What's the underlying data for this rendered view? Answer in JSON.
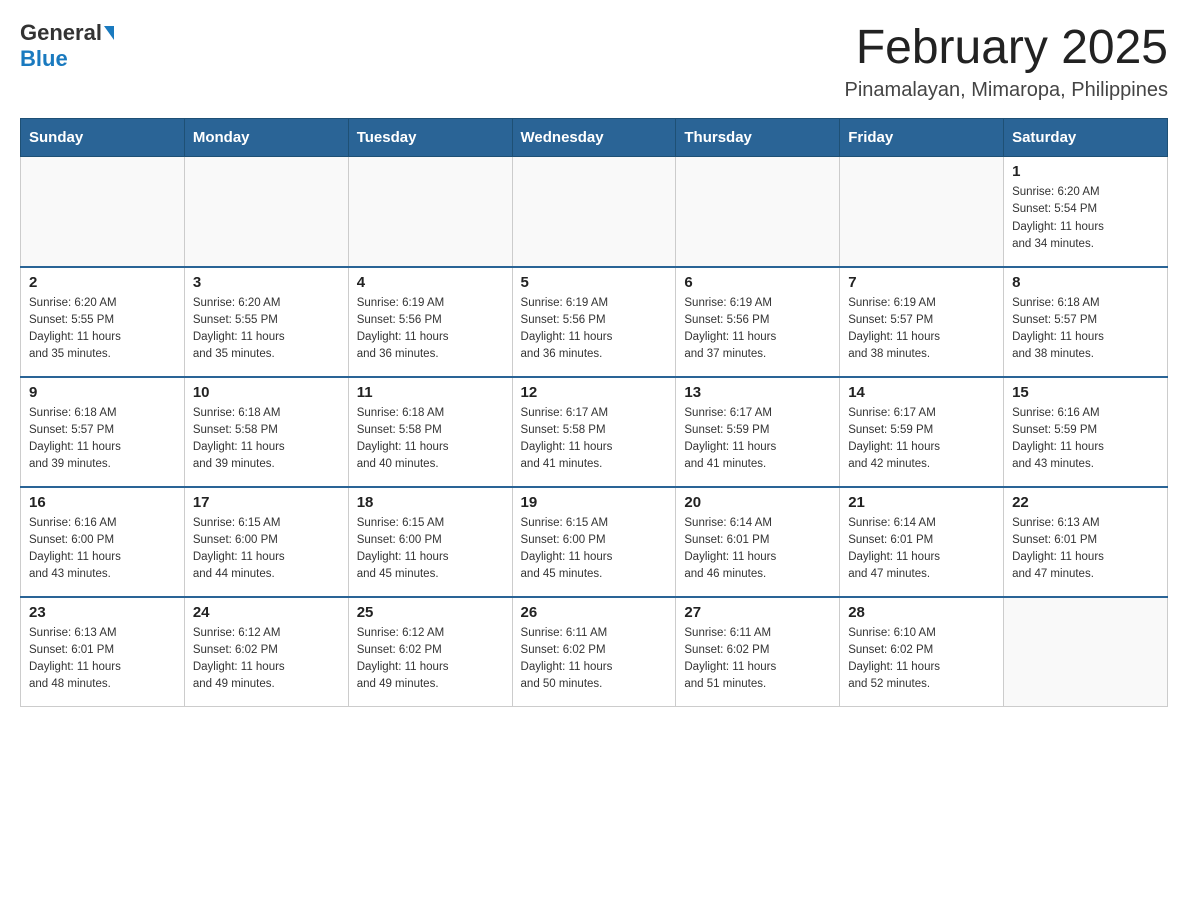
{
  "header": {
    "logo_general": "General",
    "logo_blue": "Blue",
    "main_title": "February 2025",
    "subtitle": "Pinamalayan, Mimaropa, Philippines"
  },
  "days_of_week": [
    "Sunday",
    "Monday",
    "Tuesday",
    "Wednesday",
    "Thursday",
    "Friday",
    "Saturday"
  ],
  "weeks": [
    {
      "days": [
        {
          "num": "",
          "info": ""
        },
        {
          "num": "",
          "info": ""
        },
        {
          "num": "",
          "info": ""
        },
        {
          "num": "",
          "info": ""
        },
        {
          "num": "",
          "info": ""
        },
        {
          "num": "",
          "info": ""
        },
        {
          "num": "1",
          "info": "Sunrise: 6:20 AM\nSunset: 5:54 PM\nDaylight: 11 hours\nand 34 minutes."
        }
      ]
    },
    {
      "days": [
        {
          "num": "2",
          "info": "Sunrise: 6:20 AM\nSunset: 5:55 PM\nDaylight: 11 hours\nand 35 minutes."
        },
        {
          "num": "3",
          "info": "Sunrise: 6:20 AM\nSunset: 5:55 PM\nDaylight: 11 hours\nand 35 minutes."
        },
        {
          "num": "4",
          "info": "Sunrise: 6:19 AM\nSunset: 5:56 PM\nDaylight: 11 hours\nand 36 minutes."
        },
        {
          "num": "5",
          "info": "Sunrise: 6:19 AM\nSunset: 5:56 PM\nDaylight: 11 hours\nand 36 minutes."
        },
        {
          "num": "6",
          "info": "Sunrise: 6:19 AM\nSunset: 5:56 PM\nDaylight: 11 hours\nand 37 minutes."
        },
        {
          "num": "7",
          "info": "Sunrise: 6:19 AM\nSunset: 5:57 PM\nDaylight: 11 hours\nand 38 minutes."
        },
        {
          "num": "8",
          "info": "Sunrise: 6:18 AM\nSunset: 5:57 PM\nDaylight: 11 hours\nand 38 minutes."
        }
      ]
    },
    {
      "days": [
        {
          "num": "9",
          "info": "Sunrise: 6:18 AM\nSunset: 5:57 PM\nDaylight: 11 hours\nand 39 minutes."
        },
        {
          "num": "10",
          "info": "Sunrise: 6:18 AM\nSunset: 5:58 PM\nDaylight: 11 hours\nand 39 minutes."
        },
        {
          "num": "11",
          "info": "Sunrise: 6:18 AM\nSunset: 5:58 PM\nDaylight: 11 hours\nand 40 minutes."
        },
        {
          "num": "12",
          "info": "Sunrise: 6:17 AM\nSunset: 5:58 PM\nDaylight: 11 hours\nand 41 minutes."
        },
        {
          "num": "13",
          "info": "Sunrise: 6:17 AM\nSunset: 5:59 PM\nDaylight: 11 hours\nand 41 minutes."
        },
        {
          "num": "14",
          "info": "Sunrise: 6:17 AM\nSunset: 5:59 PM\nDaylight: 11 hours\nand 42 minutes."
        },
        {
          "num": "15",
          "info": "Sunrise: 6:16 AM\nSunset: 5:59 PM\nDaylight: 11 hours\nand 43 minutes."
        }
      ]
    },
    {
      "days": [
        {
          "num": "16",
          "info": "Sunrise: 6:16 AM\nSunset: 6:00 PM\nDaylight: 11 hours\nand 43 minutes."
        },
        {
          "num": "17",
          "info": "Sunrise: 6:15 AM\nSunset: 6:00 PM\nDaylight: 11 hours\nand 44 minutes."
        },
        {
          "num": "18",
          "info": "Sunrise: 6:15 AM\nSunset: 6:00 PM\nDaylight: 11 hours\nand 45 minutes."
        },
        {
          "num": "19",
          "info": "Sunrise: 6:15 AM\nSunset: 6:00 PM\nDaylight: 11 hours\nand 45 minutes."
        },
        {
          "num": "20",
          "info": "Sunrise: 6:14 AM\nSunset: 6:01 PM\nDaylight: 11 hours\nand 46 minutes."
        },
        {
          "num": "21",
          "info": "Sunrise: 6:14 AM\nSunset: 6:01 PM\nDaylight: 11 hours\nand 47 minutes."
        },
        {
          "num": "22",
          "info": "Sunrise: 6:13 AM\nSunset: 6:01 PM\nDaylight: 11 hours\nand 47 minutes."
        }
      ]
    },
    {
      "days": [
        {
          "num": "23",
          "info": "Sunrise: 6:13 AM\nSunset: 6:01 PM\nDaylight: 11 hours\nand 48 minutes."
        },
        {
          "num": "24",
          "info": "Sunrise: 6:12 AM\nSunset: 6:02 PM\nDaylight: 11 hours\nand 49 minutes."
        },
        {
          "num": "25",
          "info": "Sunrise: 6:12 AM\nSunset: 6:02 PM\nDaylight: 11 hours\nand 49 minutes."
        },
        {
          "num": "26",
          "info": "Sunrise: 6:11 AM\nSunset: 6:02 PM\nDaylight: 11 hours\nand 50 minutes."
        },
        {
          "num": "27",
          "info": "Sunrise: 6:11 AM\nSunset: 6:02 PM\nDaylight: 11 hours\nand 51 minutes."
        },
        {
          "num": "28",
          "info": "Sunrise: 6:10 AM\nSunset: 6:02 PM\nDaylight: 11 hours\nand 52 minutes."
        },
        {
          "num": "",
          "info": ""
        }
      ]
    }
  ]
}
